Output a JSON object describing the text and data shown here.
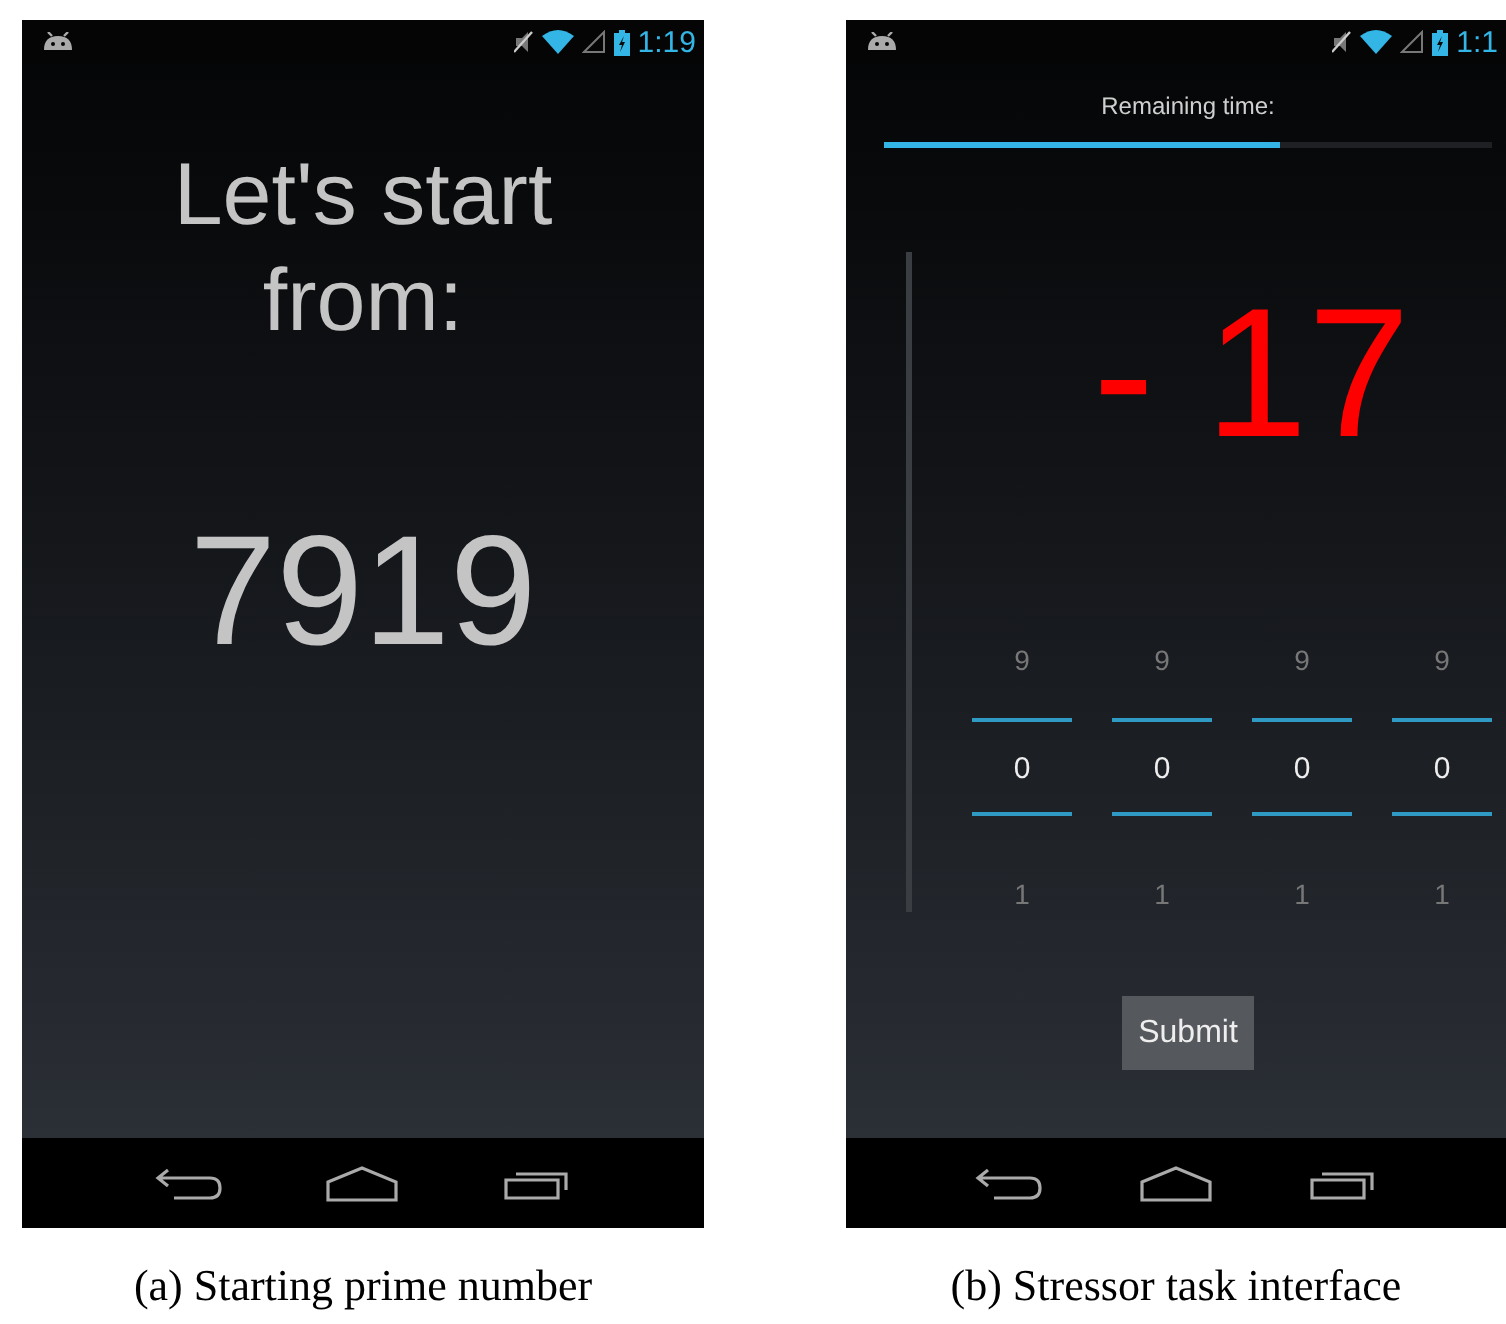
{
  "panels": [
    {
      "kind": "start",
      "status_bar": {
        "time": "1:19"
      },
      "heading": "Let's start from:",
      "number": "7919",
      "caption": "(a) Starting prime number"
    },
    {
      "kind": "stressor",
      "status_bar": {
        "time": "1:1"
      },
      "progress": {
        "label": "Remaining time:",
        "level": 0.65
      },
      "result": "- 17",
      "pickers": [
        {
          "above": "9",
          "value": "0",
          "below": "1"
        },
        {
          "above": "9",
          "value": "0",
          "below": "1"
        },
        {
          "above": "9",
          "value": "0",
          "below": "1"
        },
        {
          "above": "9",
          "value": "0",
          "below": "1"
        }
      ],
      "submit": "Submit",
      "caption": "(b) Stressor task interface"
    }
  ]
}
